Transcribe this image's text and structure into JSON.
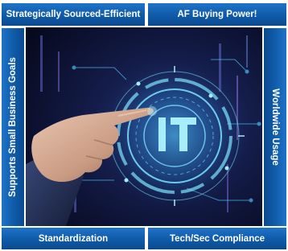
{
  "bands": {
    "top_left": "Strategically Sourced-Efficient",
    "top_right": "AF Buying Power!",
    "left": "Supports Small Business Goals",
    "right": "Worldwide Usage",
    "bottom_left": "Standardization",
    "bottom_right": "Tech/Sec Compliance"
  },
  "center": {
    "label": "IT"
  },
  "colors": {
    "band_blue": "#0f5aa8",
    "band_light": "#1f73c9",
    "background_dark": "#0a1030",
    "glow_cyan": "#5fe6ff"
  },
  "icons": {
    "hand": "pointing-hand-photo",
    "circuit": "circuit-ring-graphic"
  }
}
